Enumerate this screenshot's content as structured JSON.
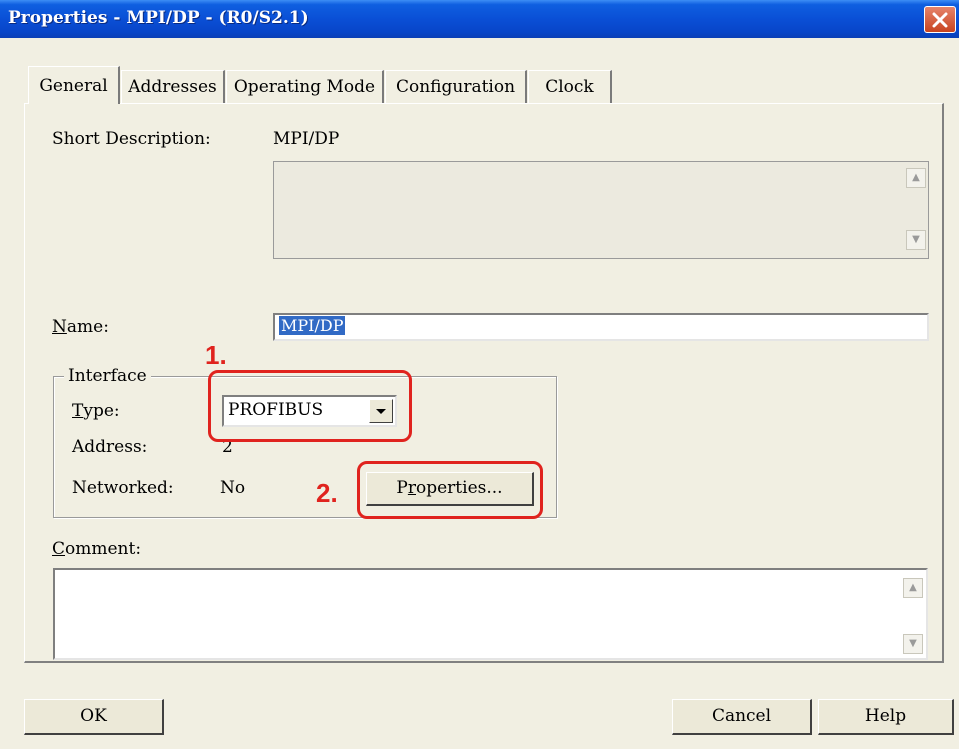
{
  "window": {
    "title": "Properties - MPI/DP - (R0/S2.1)",
    "close_icon": "close-icon",
    "title_color": "#0a4fd6",
    "close_color": "#c8431f"
  },
  "tabs": [
    {
      "label": "General",
      "active": true
    },
    {
      "label": "Addresses",
      "active": false
    },
    {
      "label": "Operating Mode",
      "active": false
    },
    {
      "label": "Configuration",
      "active": false
    },
    {
      "label": "Clock",
      "active": false
    }
  ],
  "general": {
    "short_description_label": "Short Description:",
    "short_description_value": "MPI/DP",
    "name_label_rest": "ame:",
    "name_label_mnemonic": "N",
    "name_value": "MPI/DP",
    "interface": {
      "legend": "Interface",
      "type_label_mnemonic": "T",
      "type_label_rest": "ype:",
      "type_value": "PROFIBUS",
      "address_label": "Address:",
      "address_value": "2",
      "networked_label": "Networked:",
      "networked_value": "No",
      "properties_button_mnemonic": "r",
      "properties_button_pre": "P",
      "properties_button_post": "operties..."
    },
    "comment_label_mnemonic": "C",
    "comment_label_rest": "omment:",
    "comment_value": ""
  },
  "annotations": {
    "step1": "1.",
    "step2": "2.",
    "color": "#e0231e"
  },
  "footer": {
    "ok_label": "OK",
    "cancel_label": "Cancel",
    "help_label": "Help"
  }
}
